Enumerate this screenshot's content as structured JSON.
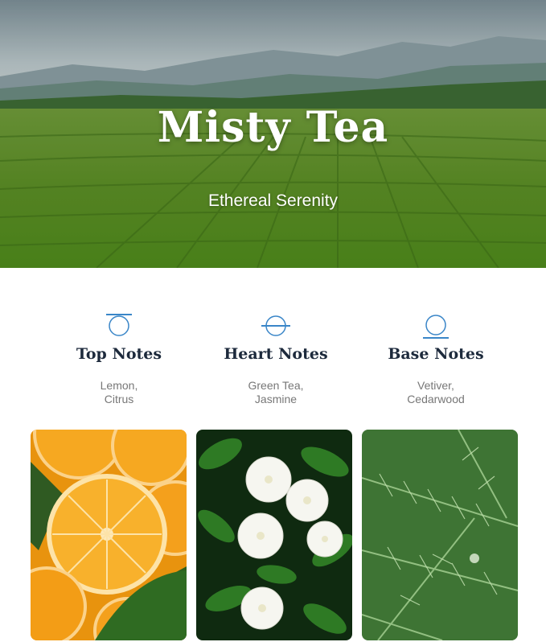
{
  "hero": {
    "title": "Misty Tea",
    "subtitle": "Ethereal Serenity"
  },
  "notes": [
    {
      "heading": "Top Notes",
      "line1": "Lemon,",
      "line2": "Citrus",
      "icon": "sunrise-circle-icon"
    },
    {
      "heading": "Heart Notes",
      "line1": "Green Tea,",
      "line2": "Jasmine",
      "icon": "crossed-circle-icon"
    },
    {
      "heading": "Base Notes",
      "line1": "Vetiver,",
      "line2": "Cedarwood",
      "icon": "sunset-circle-icon"
    }
  ],
  "photos": [
    {
      "name": "orange-slices-photo"
    },
    {
      "name": "gardenia-flowers-photo"
    },
    {
      "name": "rosemary-plant-photo"
    }
  ],
  "colors": {
    "accent": "#3a86c8",
    "heading": "#1d2a3c",
    "muted": "#777777"
  }
}
